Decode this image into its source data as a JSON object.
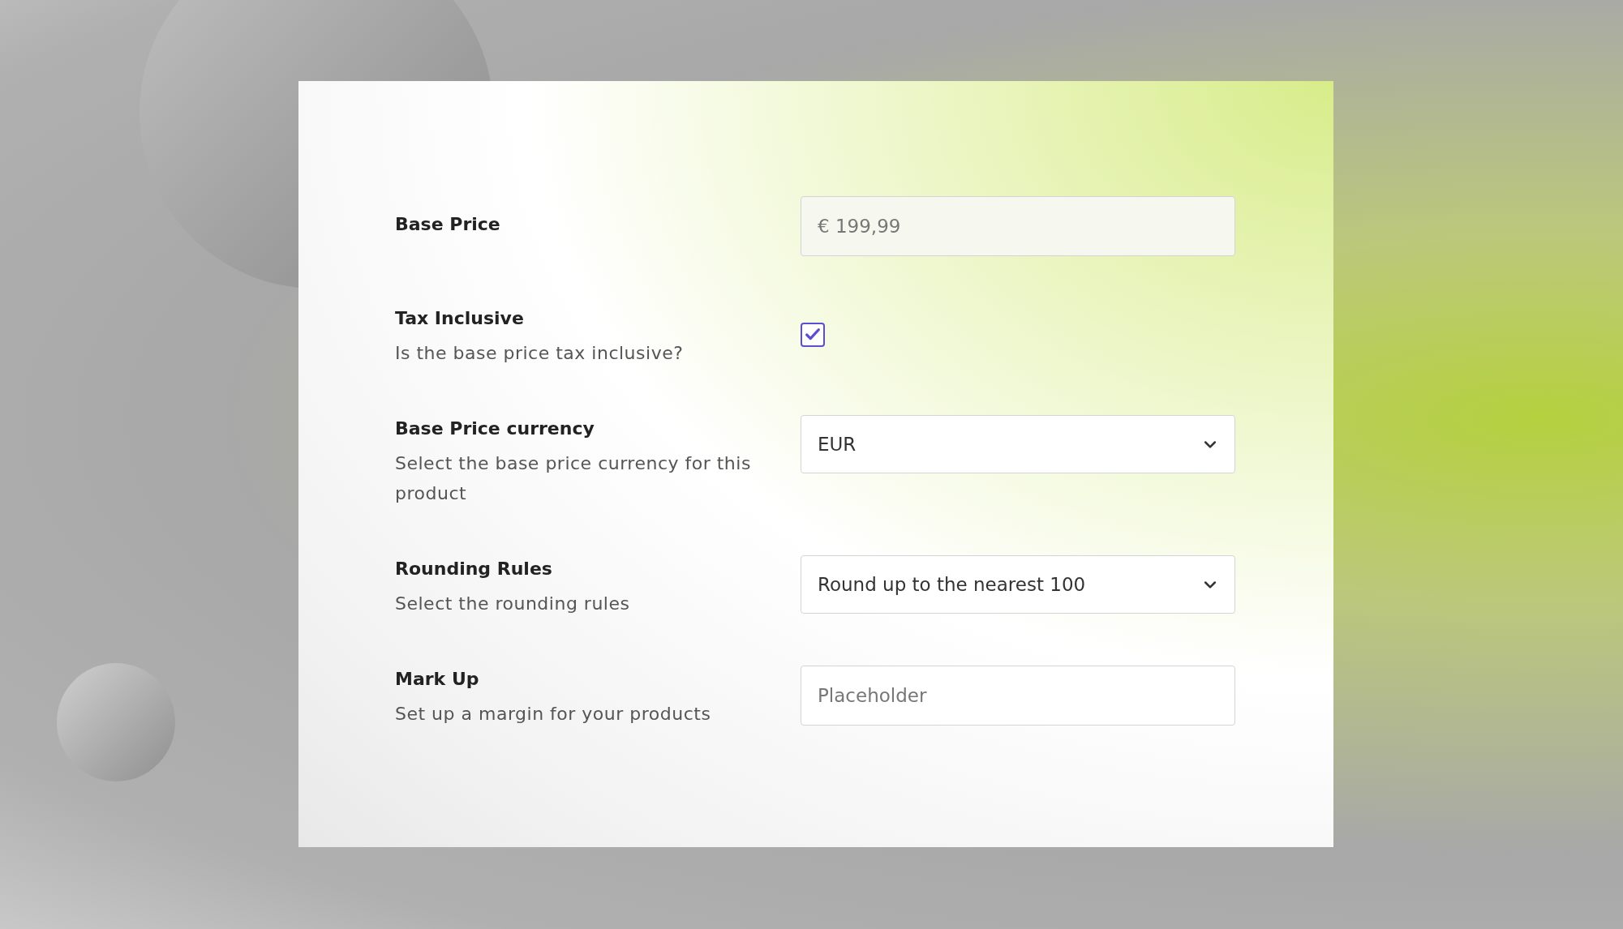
{
  "form": {
    "rows": [
      {
        "kind": "text",
        "label": "Base Price",
        "placeholder": "€ 199,99"
      },
      {
        "kind": "checkbox",
        "label": "Tax Inclusive",
        "description": "Is the base price tax inclusive?",
        "checked": true
      },
      {
        "kind": "select",
        "label": "Base Price currency",
        "description": "Select the base price currency for this product",
        "value": "EUR"
      },
      {
        "kind": "select",
        "label": "Rounding Rules",
        "description": "Select the rounding rules",
        "value": "Round up to the nearest 100"
      },
      {
        "kind": "text",
        "label": "Mark Up",
        "description": "Set up a margin for your products",
        "placeholder": "Placeholder"
      }
    ]
  }
}
